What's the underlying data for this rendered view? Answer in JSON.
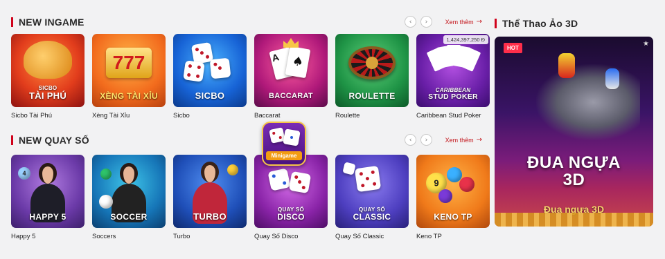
{
  "sections": [
    {
      "title": "NEW INGAME",
      "see_more": "Xem thêm",
      "cards": [
        {
          "name": "Sicbo Tài Phú",
          "thumb_small": "SICBO",
          "thumb_big": "TÀI PHÚ"
        },
        {
          "name": "Xèng Tài Xỉu",
          "thumb_small": "",
          "thumb_big": "XÈNG TÀI XỈU"
        },
        {
          "name": "Sicbo",
          "thumb_small": "",
          "thumb_big": "SICBO"
        },
        {
          "name": "Baccarat",
          "thumb_small": "",
          "thumb_big": "BACCARAT"
        },
        {
          "name": "Roulette",
          "thumb_small": "",
          "thumb_big": "ROULETTE"
        },
        {
          "name": "Caribbean Stud Poker",
          "thumb_small": "CARIBBEAN",
          "thumb_big": "STUD POKER",
          "jackpot": "1,424,397,250 Đ"
        }
      ]
    },
    {
      "title": "NEW QUAY SỐ",
      "see_more": "Xem thêm",
      "cards": [
        {
          "name": "Happy 5",
          "thumb_small": "",
          "thumb_big": "HAPPY 5"
        },
        {
          "name": "Soccers",
          "thumb_small": "",
          "thumb_big": "SOCCER"
        },
        {
          "name": "Turbo",
          "thumb_small": "",
          "thumb_big": "TURBO"
        },
        {
          "name": "Quay Số Disco",
          "thumb_small": "QUAY SỐ",
          "thumb_big": "DISCO"
        },
        {
          "name": "Quay Số Classic",
          "thumb_small": "QUAY SỐ",
          "thumb_big": "CLASSIC"
        },
        {
          "name": "Keno TP",
          "thumb_small": "",
          "thumb_big": "KENO TP"
        }
      ]
    }
  ],
  "side": {
    "title": "Thể Thao Ảo 3D",
    "badge": "HOT",
    "banner_line1": "ĐUA NGỰA",
    "banner_line2": "3D",
    "banner_sub": "Đua ngựa 3D"
  },
  "minigame": {
    "label": "Minigame"
  },
  "icons": {
    "prev": "chevron-left-icon",
    "next": "chevron-right-icon",
    "arrow": "arrow-right-icon",
    "star": "star-icon"
  },
  "colors": {
    "accent": "#d0021b",
    "link": "#c4161c",
    "hot": "#ff2e4a"
  }
}
